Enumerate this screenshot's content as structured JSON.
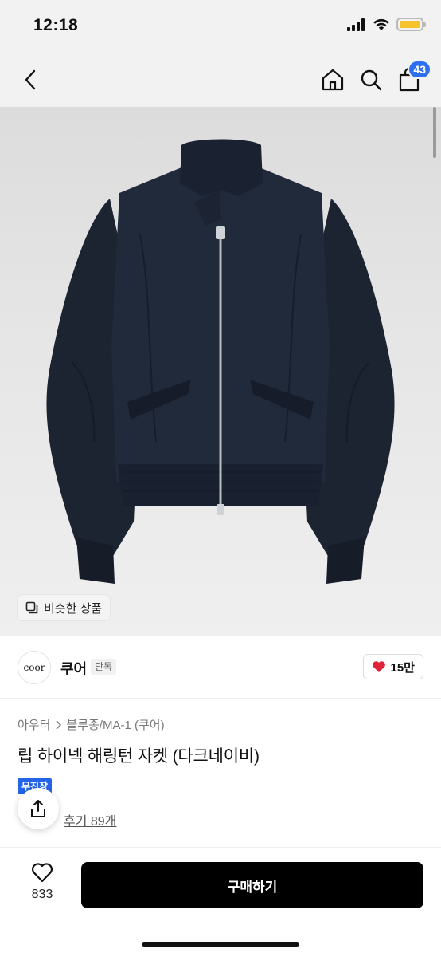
{
  "status_bar": {
    "time": "12:18"
  },
  "nav": {
    "cart_count": "43"
  },
  "image": {
    "similar_label": "비슷한 상품"
  },
  "brand": {
    "logo_text": "coor",
    "name": "쿠어",
    "tag": "단독",
    "likes": "15만"
  },
  "product": {
    "category_main": "아우터",
    "category_sub": "블루종/MA-1 (쿠어)",
    "title": "립 하이넥 해링턴 자켓 (다크네이비)",
    "badge": "무진장",
    "review_label": "후기 89개"
  },
  "bottom_bar": {
    "wish_count": "833",
    "buy_label": "구매하기"
  },
  "colors": {
    "accent": "#2e6ff2",
    "heart": "#e1223b",
    "buy_button": "#000000"
  }
}
